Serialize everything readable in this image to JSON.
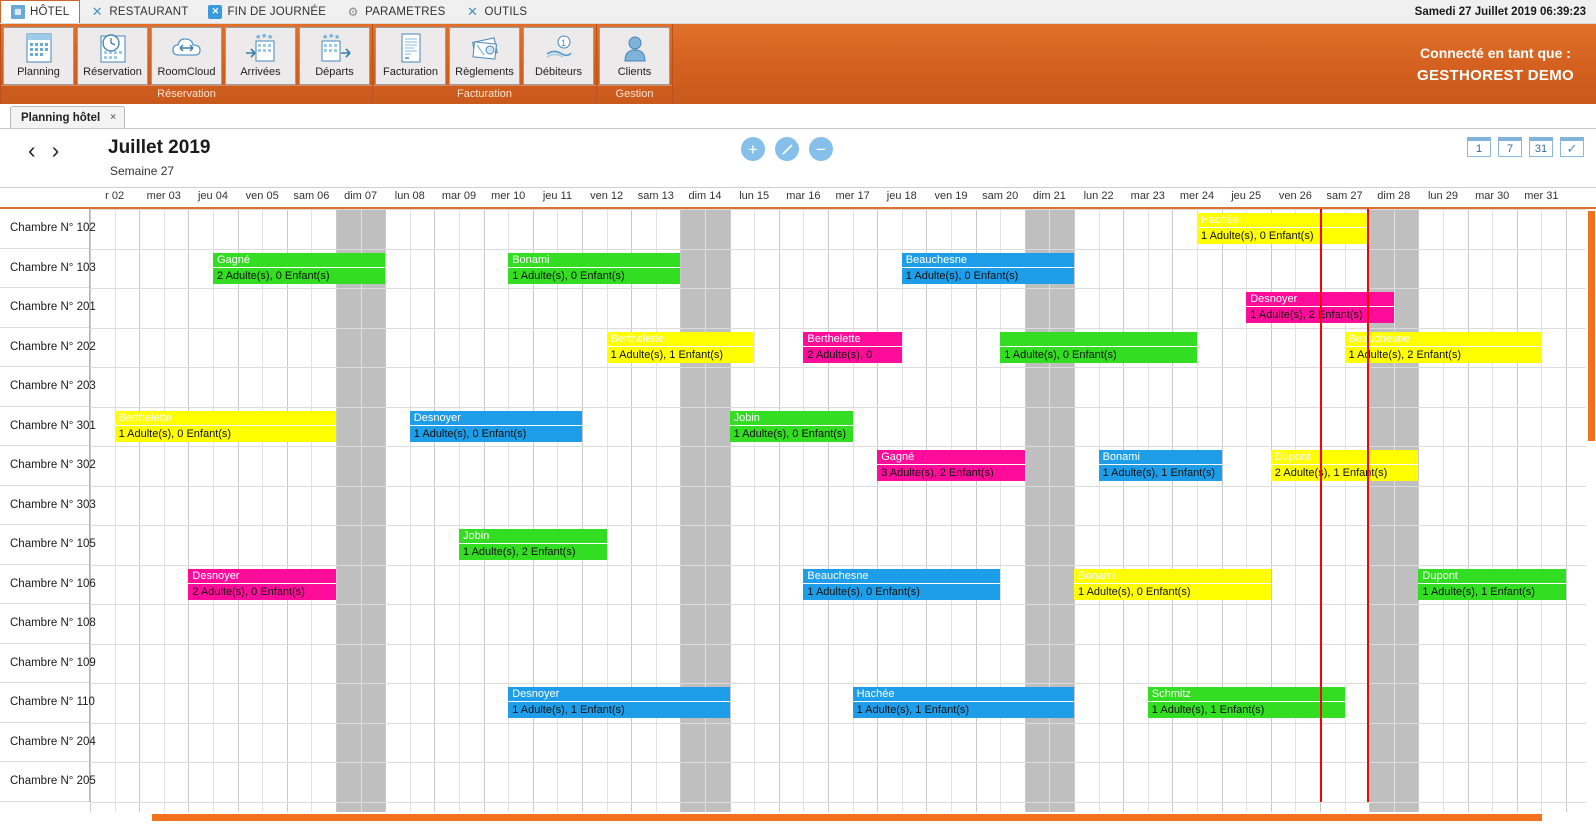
{
  "menubar": {
    "items": [
      {
        "label": "HÔTEL",
        "icon": "hotel-icon",
        "active": true
      },
      {
        "label": "RESTAURANT",
        "icon": "restaurant-icon",
        "active": false
      },
      {
        "label": "FIN DE JOURNÉE",
        "icon": "end-of-day-icon",
        "active": false
      },
      {
        "label": "PARAMETRES",
        "icon": "settings-gear-icon",
        "active": false
      },
      {
        "label": "OUTILS",
        "icon": "tools-icon",
        "active": false
      }
    ],
    "clock": "Samedi 27 Juillet 2019 06:39:23"
  },
  "ribbon": {
    "groups": [
      {
        "label": "Réservation",
        "buttons": [
          {
            "label": "Planning",
            "icon": "calendar-icon"
          },
          {
            "label": "Réservation",
            "icon": "clock-calendar-icon"
          },
          {
            "label": "RoomCloud",
            "icon": "cloud-arrows-icon"
          },
          {
            "label": "Arrivées",
            "icon": "hotel-arrival-icon"
          },
          {
            "label": "Départs",
            "icon": "hotel-departure-icon"
          }
        ]
      },
      {
        "label": "Facturation",
        "buttons": [
          {
            "label": "Facturation",
            "icon": "invoice-icon"
          },
          {
            "label": "Règlements",
            "icon": "payment-card-icon"
          },
          {
            "label": "Débiteurs",
            "icon": "coin-hand-icon"
          }
        ]
      },
      {
        "label": "Gestion",
        "buttons": [
          {
            "label": "Clients",
            "icon": "user-icon"
          }
        ]
      }
    ],
    "connected_label": "Connecté en tant que :",
    "connected_user": "GESTHOREST DEMO"
  },
  "tab": {
    "label": "Planning hôtel",
    "close": "×"
  },
  "planning_header": {
    "prev_arrow": "‹",
    "next_arrow": "›",
    "month": "Juillet 2019",
    "week": "Semaine 27",
    "actions": [
      {
        "name": "add-reservation-button",
        "glyph": "+"
      },
      {
        "name": "edit-reservation-button",
        "glyph": "pencil"
      },
      {
        "name": "delete-reservation-button",
        "glyph": "−"
      }
    ],
    "views": [
      {
        "label": "1",
        "name": "view-1-day-button"
      },
      {
        "label": "7",
        "name": "view-7-days-button"
      },
      {
        "label": "31",
        "name": "view-31-days-button"
      },
      {
        "label": "✓",
        "name": "view-confirm-button"
      }
    ]
  },
  "grid": {
    "day_width": 49.2,
    "row_height": 39.5,
    "first_day_index": 1,
    "days": [
      {
        "label": "r 02",
        "weekend": false
      },
      {
        "label": "mer 03",
        "weekend": false
      },
      {
        "label": "jeu 04",
        "weekend": false
      },
      {
        "label": "ven 05",
        "weekend": false
      },
      {
        "label": "sam 06",
        "weekend": false
      },
      {
        "label": "dim 07",
        "weekend": true
      },
      {
        "label": "lun 08",
        "weekend": false
      },
      {
        "label": "mar 09",
        "weekend": false
      },
      {
        "label": "mer 10",
        "weekend": false
      },
      {
        "label": "jeu 11",
        "weekend": false
      },
      {
        "label": "ven 12",
        "weekend": false
      },
      {
        "label": "sam 13",
        "weekend": false
      },
      {
        "label": "dim 14",
        "weekend": true
      },
      {
        "label": "lun 15",
        "weekend": false
      },
      {
        "label": "mar 16",
        "weekend": false
      },
      {
        "label": "mer 17",
        "weekend": false
      },
      {
        "label": "jeu 18",
        "weekend": false
      },
      {
        "label": "ven 19",
        "weekend": false
      },
      {
        "label": "sam 20",
        "weekend": false
      },
      {
        "label": "dim 21",
        "weekend": true
      },
      {
        "label": "lun 22",
        "weekend": false
      },
      {
        "label": "mar 23",
        "weekend": false
      },
      {
        "label": "mer 24",
        "weekend": false
      },
      {
        "label": "jeu 25",
        "weekend": false
      },
      {
        "label": "ven 26",
        "weekend": false
      },
      {
        "label": "sam 27",
        "weekend": false
      },
      {
        "label": "dim 28",
        "weekend": true
      },
      {
        "label": "lun 29",
        "weekend": false
      },
      {
        "label": "mar 30",
        "weekend": false
      },
      {
        "label": "mer 31",
        "weekend": false
      }
    ],
    "rooms": [
      "Chambre N° 102",
      "Chambre N° 103",
      "Chambre N° 201",
      "Chambre N° 202",
      "Chambre N° 203",
      "Chambre N° 301",
      "Chambre N° 302",
      "Chambre N° 303",
      "Chambre N° 105",
      "Chambre N° 106",
      "Chambre N° 108",
      "Chambre N° 109",
      "Chambre N° 110",
      "Chambre N° 204",
      "Chambre N° 205"
    ],
    "today_column_index": 25,
    "colors": {
      "green": "#33dd22",
      "yellow": "#ffff00",
      "blue": "#1e9ee8",
      "magenta": "#ff0d9a",
      "weekend": "#bfbfbf",
      "today_border": "#ff0000",
      "accent": "#e0712c"
    },
    "reservations": [
      {
        "room": 0,
        "start": 22.5,
        "end": 26.0,
        "color": "yellow",
        "name": "Hachée",
        "occupancy": "1 Adulte(s), 0 Enfant(s)"
      },
      {
        "room": 1,
        "start": 2.5,
        "end": 6.0,
        "color": "green",
        "name": "Gagné",
        "occupancy": "2 Adulte(s), 0 Enfant(s)"
      },
      {
        "room": 1,
        "start": 8.5,
        "end": 12.0,
        "color": "green",
        "name": "Bonami",
        "occupancy": "1 Adulte(s), 0 Enfant(s)"
      },
      {
        "room": 1,
        "start": 16.5,
        "end": 20.0,
        "color": "blue",
        "name": "Beauchesne",
        "occupancy": "1 Adulte(s), 0 Enfant(s)"
      },
      {
        "room": 2,
        "start": 23.5,
        "end": 26.5,
        "color": "magenta",
        "name": "Desnoyer",
        "occupancy": "1 Adulte(s), 2 Enfant(s)"
      },
      {
        "room": 3,
        "start": 10.5,
        "end": 13.5,
        "color": "yellow",
        "name": "Berthelette",
        "occupancy": "1 Adulte(s), 1 Enfant(s)"
      },
      {
        "room": 3,
        "start": 14.5,
        "end": 16.5,
        "color": "magenta",
        "name": "Berthelette",
        "occupancy": "2 Adulte(s), 0"
      },
      {
        "room": 3,
        "start": 18.5,
        "end": 22.5,
        "color": "green",
        "name": "",
        "occupancy": "1 Adulte(s), 0 Enfant(s)"
      },
      {
        "room": 3,
        "start": 25.5,
        "end": 29.5,
        "color": "yellow",
        "name": "Beauchesne",
        "occupancy": "1 Adulte(s), 2 Enfant(s)"
      },
      {
        "room": 5,
        "start": 0.5,
        "end": 5.0,
        "color": "yellow",
        "name": "Berthelette",
        "occupancy": "1 Adulte(s), 0 Enfant(s)"
      },
      {
        "room": 5,
        "start": 6.5,
        "end": 10.0,
        "color": "blue",
        "name": "Desnoyer",
        "occupancy": "1 Adulte(s), 0 Enfant(s)"
      },
      {
        "room": 5,
        "start": 13.0,
        "end": 15.5,
        "color": "green",
        "name": "Jobin",
        "occupancy": "1 Adulte(s), 0 Enfant(s)"
      },
      {
        "room": 6,
        "start": 16.0,
        "end": 19.0,
        "color": "magenta",
        "name": "Gagné",
        "occupancy": "3 Adulte(s), 2 Enfant(s)"
      },
      {
        "room": 6,
        "start": 20.5,
        "end": 23.0,
        "color": "blue",
        "name": "Bonami",
        "occupancy": "1 Adulte(s), 1 Enfant(s)"
      },
      {
        "room": 6,
        "start": 24.0,
        "end": 27.0,
        "color": "yellow",
        "name": "Dupont",
        "occupancy": "2 Adulte(s), 1 Enfant(s)"
      },
      {
        "room": 8,
        "start": 7.5,
        "end": 10.5,
        "color": "green",
        "name": "Jobin",
        "occupancy": "1 Adulte(s), 2 Enfant(s)"
      },
      {
        "room": 9,
        "start": 2.0,
        "end": 5.0,
        "color": "magenta",
        "name": "Desnoyer",
        "occupancy": "2 Adulte(s), 0 Enfant(s)"
      },
      {
        "room": 9,
        "start": 14.5,
        "end": 18.5,
        "color": "blue",
        "name": "Beauchesne",
        "occupancy": "1 Adulte(s), 0 Enfant(s)"
      },
      {
        "room": 9,
        "start": 20.0,
        "end": 24.0,
        "color": "yellow",
        "name": "Bonami",
        "occupancy": "1 Adulte(s), 0 Enfant(s)"
      },
      {
        "room": 9,
        "start": 27.0,
        "end": 30.0,
        "color": "green",
        "name": "Dupont",
        "occupancy": "1 Adulte(s), 1 Enfant(s)"
      },
      {
        "room": 12,
        "start": 8.5,
        "end": 13.0,
        "color": "blue",
        "name": "Desnoyer",
        "occupancy": "1 Adulte(s), 1 Enfant(s)"
      },
      {
        "room": 12,
        "start": 15.5,
        "end": 20.0,
        "color": "blue",
        "name": "Hachée",
        "occupancy": "1 Adulte(s), 1 Enfant(s)"
      },
      {
        "room": 12,
        "start": 21.5,
        "end": 25.5,
        "color": "green",
        "name": "Schmitz",
        "occupancy": "1 Adulte(s), 1 Enfant(s)"
      }
    ]
  }
}
